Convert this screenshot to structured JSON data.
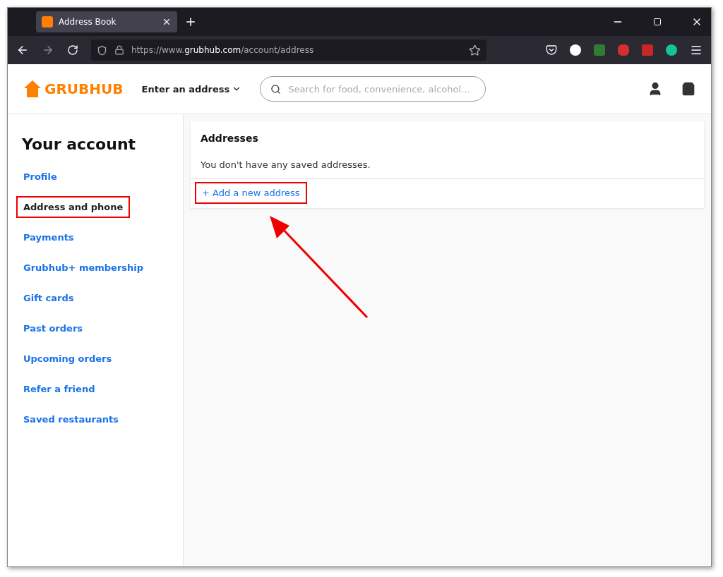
{
  "browser": {
    "tab": {
      "title": "Address Book",
      "selected": true
    },
    "url": "https://www.**grubhub.com**/account/address"
  },
  "header": {
    "logo": "GRUBHUB",
    "address_picker": "Enter an address",
    "search": {
      "placeholder": "Search for food, convenience, alcohol..."
    }
  },
  "sidebar": {
    "title": "Your account",
    "items": [
      {
        "label": "Profile",
        "selected": false,
        "highlighted": false
      },
      {
        "label": "Address and phone",
        "selected": true,
        "highlighted": true
      },
      {
        "label": "Payments",
        "selected": false,
        "highlighted": false
      },
      {
        "label": "Grubhub+ membership",
        "selected": false,
        "highlighted": false
      },
      {
        "label": "Gift cards",
        "selected": false,
        "highlighted": false
      },
      {
        "label": "Past orders",
        "selected": false,
        "highlighted": false
      },
      {
        "label": "Upcoming orders",
        "selected": false,
        "highlighted": false
      },
      {
        "label": "Refer a friend",
        "selected": false,
        "highlighted": false
      },
      {
        "label": "Saved restaurants",
        "selected": false,
        "highlighted": false
      }
    ]
  },
  "addresses": {
    "title": "Addresses",
    "empty_message": "You don't have any saved addresses.",
    "add_link": {
      "label": "+ Add a new address",
      "highlighted": true
    }
  }
}
